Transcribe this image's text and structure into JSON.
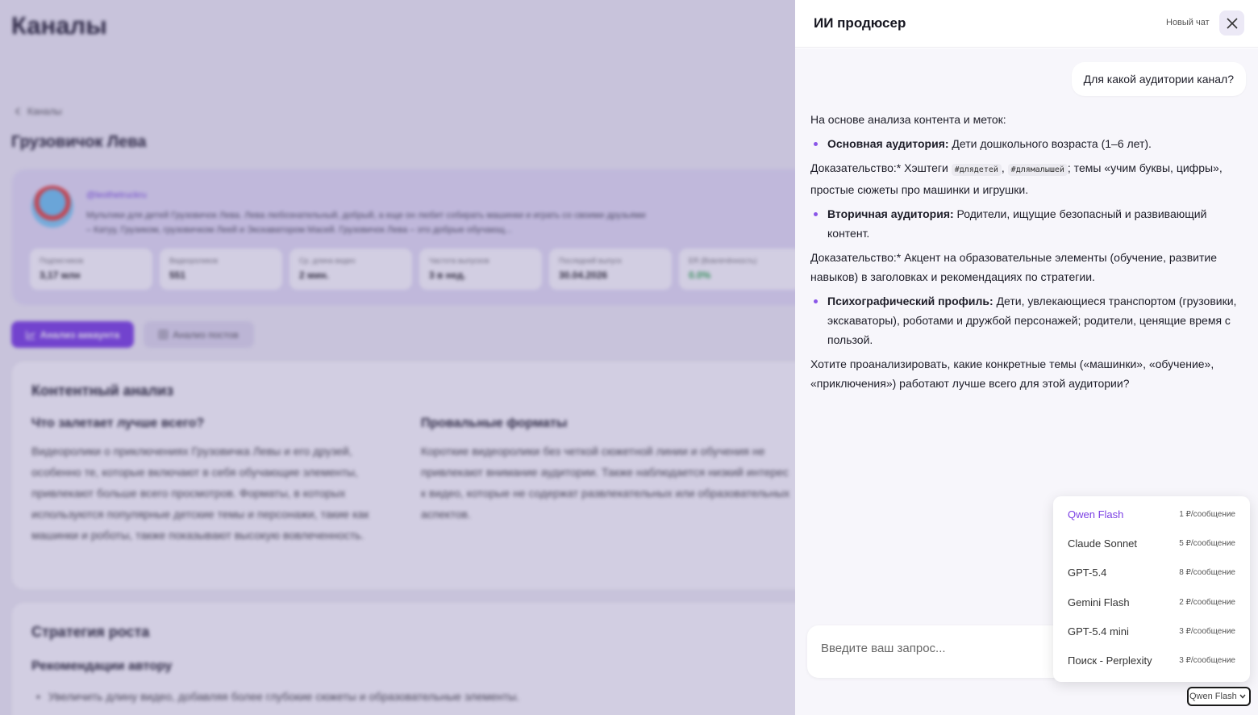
{
  "background": {
    "page_title": "Каналы",
    "breadcrumb": "Каналы",
    "channel_title": "Грузовичок Лева",
    "handle": "@leothetruckru",
    "description": "Мультики для детей Грузовичок Лева. Лева любознательный, добрый, а еще он любит собирать машинки и играть со своими друзьями – Катуу, Грузиком, грузовичком Леей и Экскаватором Масей. Грузовичок Лева – это добрые обучающ...",
    "stats": [
      {
        "label": "Подписчиков",
        "value": "3,17 млн"
      },
      {
        "label": "Видеороликов",
        "value": "551"
      },
      {
        "label": "Ср. длина видео",
        "value": "2 мин."
      },
      {
        "label": "Частота выпусков",
        "value": "3 в нед."
      },
      {
        "label": "Последний выпуск",
        "value": "30.04.2026"
      },
      {
        "label": "ER (Вовлечённость)",
        "value": "0.0%"
      }
    ],
    "btn_analysis": "Анализ аккаунта",
    "btn_posts": "Анализ постов",
    "content_title": "Контентный анализ",
    "col_left_title": "Что залетает лучше всего?",
    "col_left_text": "Видеоролики о приключениях Грузовичка Левы и его друзей, особенно те, которые включают в себя обучающие элементы, привлекают больше всего просмотров. Форматы, в которых используются популярные детские темы и персонажи, такие как машинки и роботы, также показывают высокую вовлеченность.",
    "col_right_title": "Провальные форматы",
    "col_right_text": "Короткие видеоролики без четкой сюжетной линии и обучения не привлекают внимание аудитории. Также наблюдается низкий интерес к видео, которые не содержат развлекательных или образовательных аспектов.",
    "strategy_title": "Стратегия роста",
    "strategy_sub": "Рекомендации автору",
    "strategy_items": [
      "Увеличить длину видео, добавляя более глубокие сюжеты и образовательные элементы."
    ]
  },
  "panel": {
    "title": "ИИ продюсер",
    "new_chat": "Новый чат",
    "user_message": "Для какой аудитории канал?",
    "ai": {
      "intro": "На основе анализа контента и меток:",
      "b1_label": "Основная аудитория:",
      "b1_text": " Дети дошкольного возраста (1–6 лет).",
      "evidence1_pre": "Доказательство:* Хэштеги ",
      "tag1": "#длядетей",
      "tag_sep": ", ",
      "tag2": "#длямалышей",
      "evidence1_post": "; темы «учим буквы, цифры», простые сюжеты про машинки и игрушки.",
      "b2_label": "Вторичная аудитория:",
      "b2_text": " Родители, ищущие безопасный и развивающий контент.",
      "evidence2": "Доказательство:* Акцент на образовательные элементы (обучение, развитие навыков) в заголовках и рекомендациях по стратегии.",
      "b3_label": "Психографический профиль:",
      "b3_text": " Дети, увлекающиеся транспортом (грузовики, экскаваторы), роботами и дружбой персонажей; родители, ценящие время с пользой.",
      "question": "Хотите проанализировать, какие конкретные темы («машинки», «обучение», «приключения») работают лучше всего для этой аудитории?"
    },
    "input_placeholder": "Введите ваш запрос...",
    "models": [
      {
        "name": "Qwen Flash",
        "price": "1 ₽/сообщение",
        "selected": true
      },
      {
        "name": "Claude Sonnet",
        "price": "5 ₽/сообщение"
      },
      {
        "name": "GPT-5.4",
        "price": "8 ₽/сообщение"
      },
      {
        "name": "Gemini Flash",
        "price": "2 ₽/сообщение"
      },
      {
        "name": "GPT-5.4 mini",
        "price": "3 ₽/сообщение"
      },
      {
        "name": "Поиск - Perplexity",
        "price": "3 ₽/сообщение"
      }
    ],
    "selected_model": "Qwen Flash"
  },
  "colors": {
    "accent": "#7b3fe4",
    "bullet": "#8a56e8",
    "er_value": "#2ba84a"
  },
  "icons": [
    "chevron-left-icon",
    "chart-icon",
    "grid-icon",
    "close-icon",
    "chevron-down-icon"
  ]
}
